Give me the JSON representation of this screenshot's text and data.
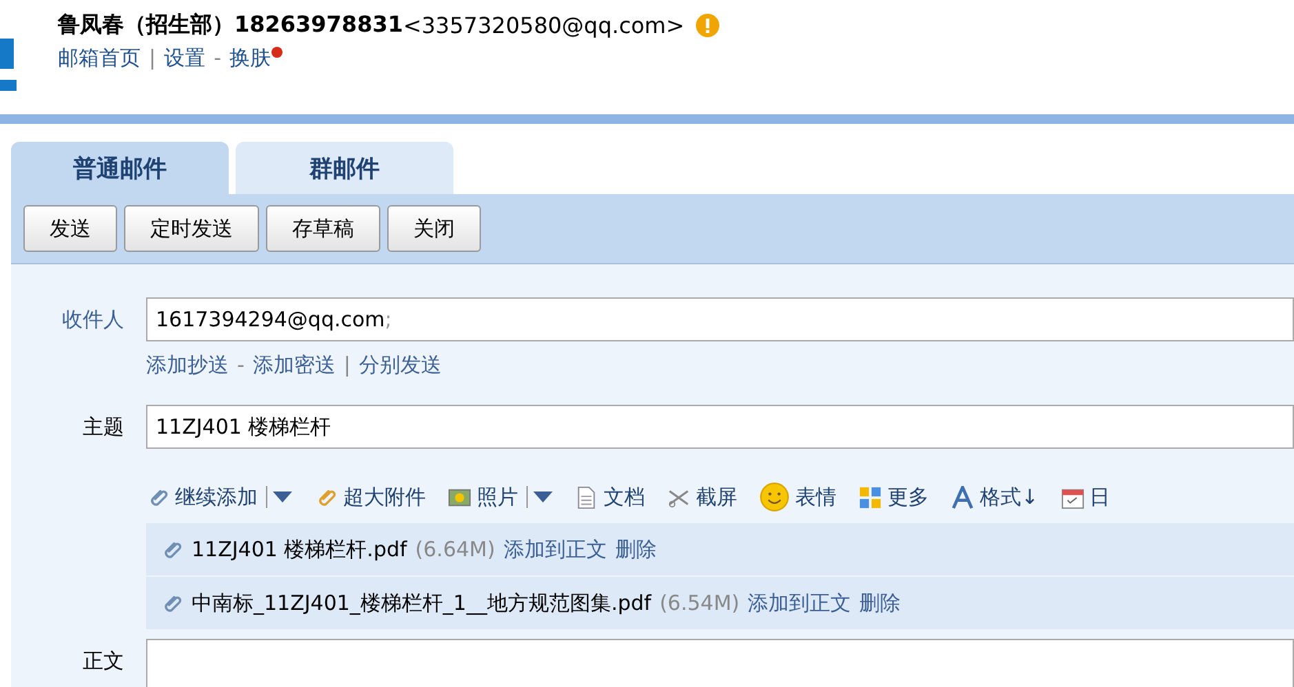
{
  "header": {
    "sender_name": "鲁凤春（招生部）18263978831",
    "sender_address": "<3357320580@qq.com>",
    "nav": [
      {
        "kind": "link",
        "label": "邮箱首页",
        "notification_dot": false
      },
      {
        "kind": "separator",
        "label": "|"
      },
      {
        "kind": "link",
        "label": "设置",
        "notification_dot": false
      },
      {
        "kind": "separator",
        "label": "-"
      },
      {
        "kind": "link",
        "label": "换肤",
        "notification_dot": true
      }
    ]
  },
  "tabs": [
    {
      "label": "普通邮件",
      "selected": true
    },
    {
      "label": "群邮件",
      "selected": false
    }
  ],
  "actions": [
    "发送",
    "定时发送",
    "存草稿",
    "关闭"
  ],
  "recipient": {
    "label": "收件人",
    "value": "1617394294@qq.com",
    "suffix": ";",
    "links": [
      {
        "kind": "link",
        "label": "添加抄送"
      },
      {
        "kind": "separator",
        "label": "-"
      },
      {
        "kind": "link",
        "label": "添加密送"
      },
      {
        "kind": "separator",
        "label": "|"
      },
      {
        "kind": "link",
        "label": "分别发送"
      }
    ]
  },
  "subject": {
    "label": "主题",
    "value": "11ZJ401 楼梯栏杆"
  },
  "attach_toolbar": [
    {
      "label": "继续添加",
      "has_menu": true
    },
    {
      "label": "超大附件",
      "has_menu": false
    },
    {
      "label": "照片",
      "has_menu": true
    },
    {
      "label": "文档",
      "has_menu": false
    },
    {
      "label": "截屏",
      "has_menu": false
    },
    {
      "label": "表情",
      "has_menu": false
    },
    {
      "label": "更多",
      "has_menu": false
    },
    {
      "label": "格式↓",
      "has_menu": false
    },
    {
      "label": "日",
      "has_menu": false
    }
  ],
  "attachments": [
    {
      "name": "11ZJ401 楼梯栏杆.pdf",
      "size": "(6.64M)",
      "actions": [
        "添加到正文",
        "删除"
      ]
    },
    {
      "name": "中南标_11ZJ401_楼梯栏杆_1__地方规范图集.pdf",
      "size": "(6.54M)",
      "actions": [
        "添加到正文",
        "删除"
      ]
    }
  ],
  "body": {
    "label": "正文"
  }
}
